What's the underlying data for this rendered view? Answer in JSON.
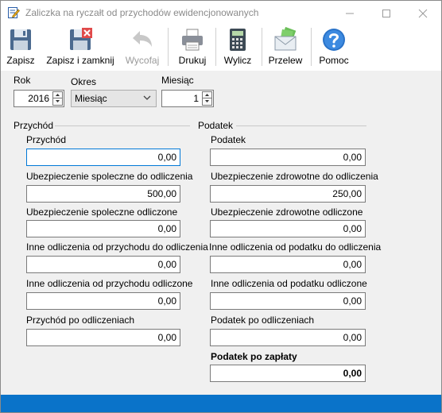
{
  "window": {
    "title": "Zaliczka na ryczałt od przychodów ewidencjonowanych"
  },
  "toolbar": {
    "save": "Zapisz",
    "save_close": "Zapisz i zamknij",
    "undo": "Wycofaj",
    "print": "Drukuj",
    "calculate": "Wylicz",
    "transfer": "Przelew",
    "help": "Pomoc"
  },
  "period": {
    "year_label": "Rok",
    "year_value": "2016",
    "period_label": "Okres",
    "period_value": "Miesiąc",
    "month_label": "Miesiąc",
    "month_value": "1"
  },
  "revenue": {
    "group_label": "Przychód",
    "revenue_label": "Przychód",
    "revenue_value": "0,00",
    "social_deduct_label": "Ubezpieczenie spoleczne do odliczenia",
    "social_deduct_value": "500,00",
    "social_deducted_label": "Ubezpieczenie spoleczne odliczone",
    "social_deducted_value": "0,00",
    "other_deduct_label": "Inne odliczenia od przychodu do odliczenia",
    "other_deduct_value": "0,00",
    "other_deducted_label": "Inne odliczenia od przychodu odliczone",
    "other_deducted_value": "0,00",
    "after_label": "Przychód po odliczeniach",
    "after_value": "0,00"
  },
  "tax": {
    "group_label": "Podatek",
    "tax_label": "Podatek",
    "tax_value": "0,00",
    "health_deduct_label": "Ubezpieczenie zdrowotne do odliczenia",
    "health_deduct_value": "250,00",
    "health_deducted_label": "Ubezpieczenie zdrowotne odliczone",
    "health_deducted_value": "0,00",
    "other_deduct_label": "Inne odliczenia od podatku do odliczenia",
    "other_deduct_value": "0,00",
    "other_deducted_label": "Inne odliczenia od podatku odliczone",
    "other_deducted_value": "0,00",
    "after_label": "Podatek po odliczeniach",
    "after_value": "0,00",
    "due_label": "Podatek po zapłaty",
    "due_value": "0,00"
  },
  "colors": {
    "accent": "#0078d7",
    "statusbar": "#0a73c9"
  }
}
